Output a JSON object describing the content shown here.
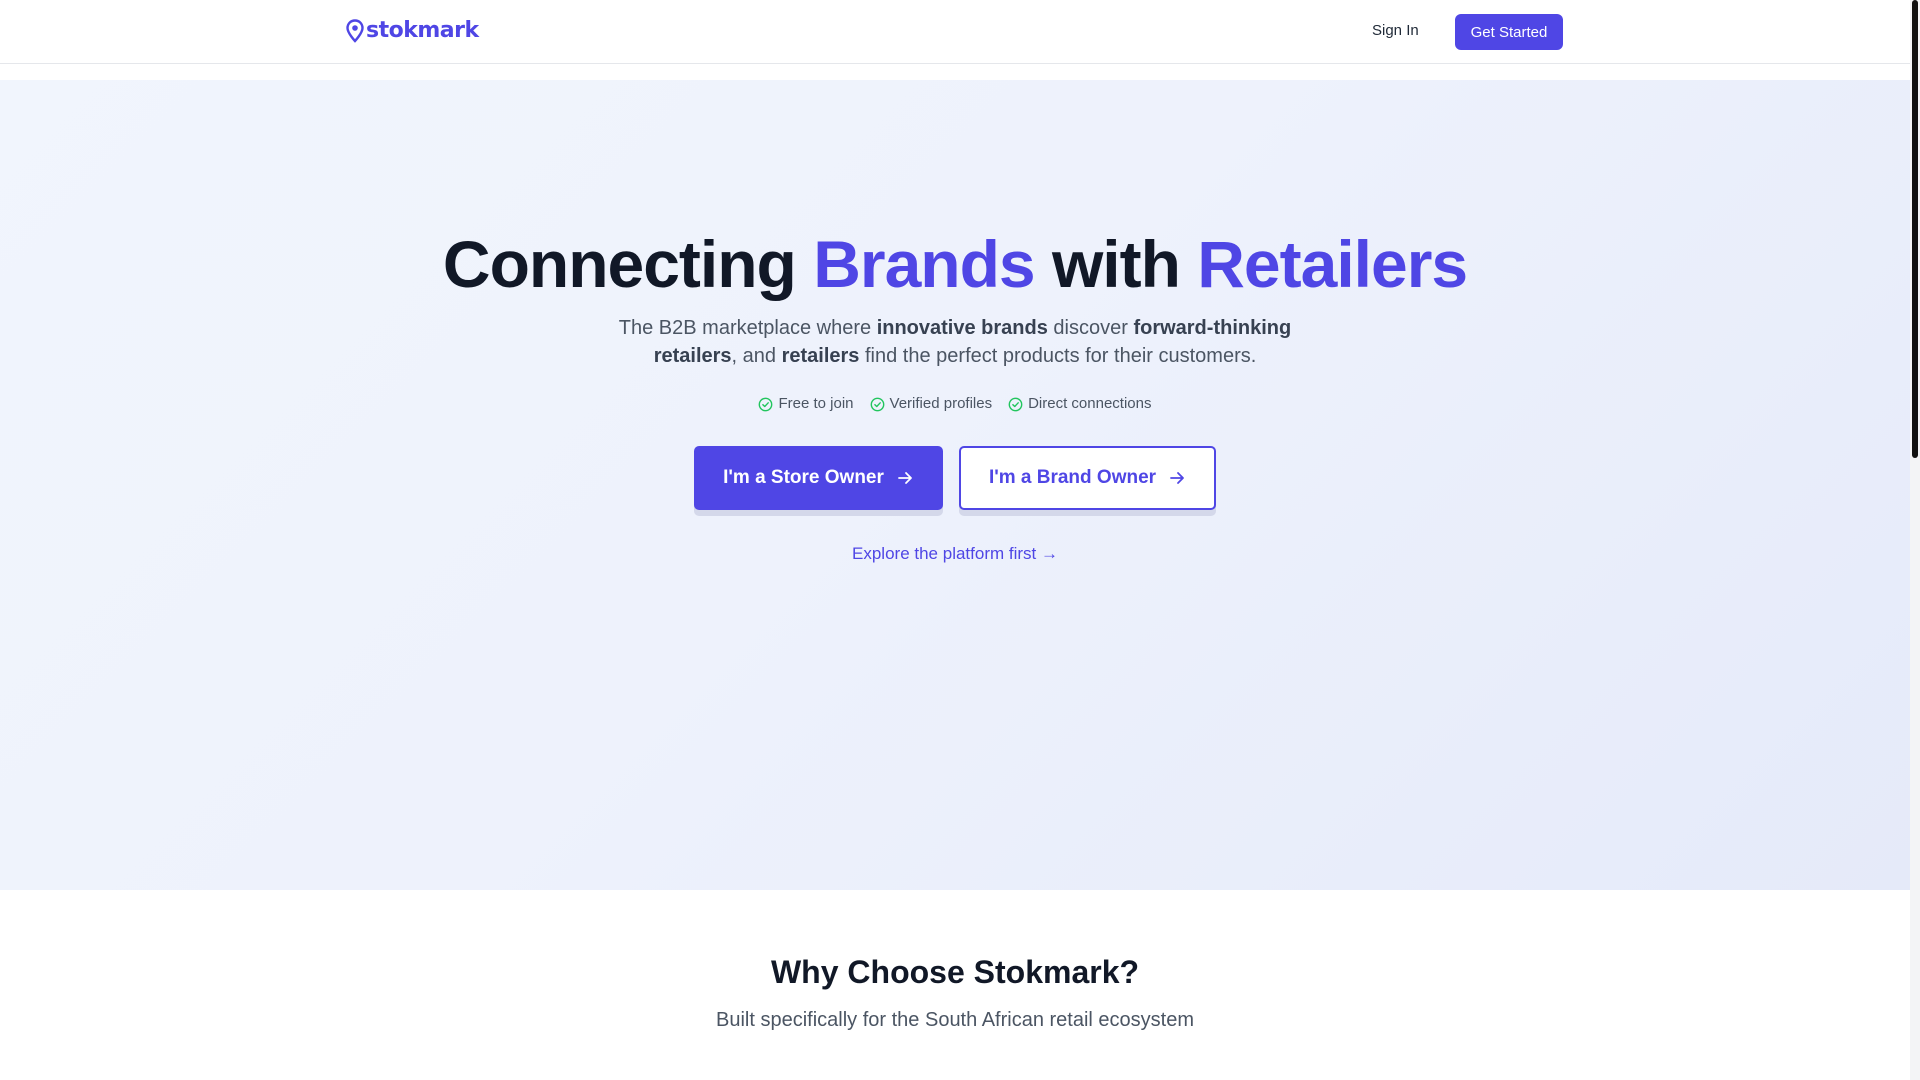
{
  "header": {
    "logo_text": "stokmark",
    "logo_icon": "map-pin-icon",
    "sign_in_label": "Sign In",
    "get_started_label": "Get Started"
  },
  "hero": {
    "title_part1": "Connecting ",
    "title_accent1": "Brands",
    "title_part2": " with ",
    "title_accent2": "Retailers",
    "subtitle": {
      "t1": "The B2B marketplace where ",
      "b1": "innovative brands",
      "t2": " discover ",
      "b2": "forward-thinking retailers",
      "t3": ", and ",
      "b3": "retailers",
      "t4": " find the perfect products for their customers."
    },
    "features": [
      {
        "label": "Free to join",
        "icon": "check-circle-icon"
      },
      {
        "label": "Verified profiles",
        "icon": "check-circle-icon"
      },
      {
        "label": "Direct connections",
        "icon": "check-circle-icon"
      }
    ],
    "store_owner_label": "I'm a Store Owner",
    "brand_owner_label": "I'm a Brand Owner",
    "explore_label": "Explore the platform first →"
  },
  "why": {
    "title": "Why Choose Stokmark?",
    "subtitle": "Built specifically for the South African retail ecosystem"
  },
  "colors": {
    "accent": "#4f46e5",
    "check": "#22c55e",
    "heading": "#111827",
    "body": "#4b5563"
  }
}
